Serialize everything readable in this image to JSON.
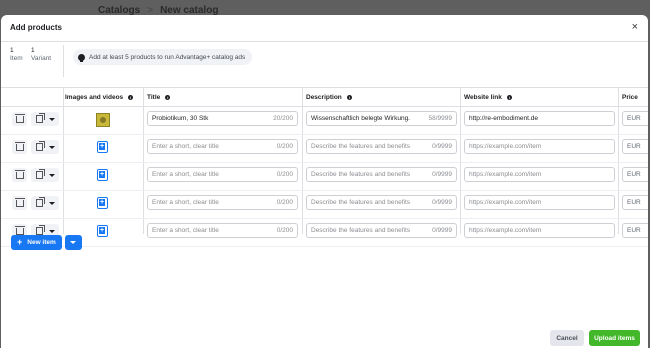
{
  "background": {
    "breadcrumb_parent": "Catalogs",
    "breadcrumb_sep": ">",
    "breadcrumb_current": "New catalog"
  },
  "modal": {
    "title": "Add products",
    "close": "×"
  },
  "stats": {
    "items_count": "1",
    "items_label": "Item",
    "variants_count": "1",
    "variants_label": "Variant"
  },
  "notice": "Add at least 5 products to run Advantage+ catalog ads",
  "columns": {
    "media": "Images and videos",
    "title": "Title",
    "description": "Description",
    "website": "Website link",
    "price": "Price"
  },
  "rows": [
    {
      "title": "Probiotikum, 30 Stk",
      "title_count": "20/200",
      "description": "Wissenschaftlich belegte Wirkung.",
      "description_count": "58/9999",
      "website": "http://re-embodiment.de",
      "currency": "EUR"
    },
    {
      "title": "",
      "title_count": "0/200",
      "description": "",
      "description_count": "0/9999",
      "website": "",
      "currency": "EUR"
    },
    {
      "title": "",
      "title_count": "0/200",
      "description": "",
      "description_count": "0/9999",
      "website": "",
      "currency": "EUR"
    },
    {
      "title": "",
      "title_count": "0/200",
      "description": "",
      "description_count": "0/9999",
      "website": "",
      "currency": "EUR"
    },
    {
      "title": "",
      "title_count": "0/200",
      "description": "",
      "description_count": "0/9999",
      "website": "",
      "currency": "EUR"
    }
  ],
  "placeholders": {
    "title": "Enter a short, clear title",
    "description": "Describe the features and benefits",
    "website": "https://example.com/item"
  },
  "buttons": {
    "new_item": "New item",
    "cancel": "Cancel",
    "upload": "Upload items"
  }
}
